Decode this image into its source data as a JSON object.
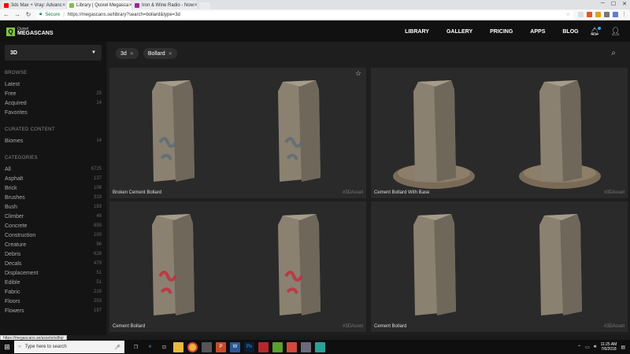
{
  "browser": {
    "tabs": [
      {
        "title": "3ds Max + Vray: Advanc",
        "color": "#ff0000",
        "active": false
      },
      {
        "title": "Library | Quixel Megasca",
        "color": "#7fc241",
        "active": true
      },
      {
        "title": "Iron & Wine Radio - Now",
        "color": "#a0249b",
        "active": false
      }
    ],
    "secure_label": "Secure",
    "url": "https://megascans.se/library?search=bollard&type=3d",
    "status_url": "https://megascans.se/assets/sdhqr"
  },
  "header": {
    "logo_mark": "Q",
    "logo_small": "Quixel",
    "logo_big": "MEGASCANS",
    "nav": [
      "LIBRARY",
      "GALLERY",
      "PRICING",
      "APPS",
      "BLOG"
    ]
  },
  "sidebar": {
    "type_select": "3D",
    "browse_title": "BROWSE",
    "browse": [
      {
        "label": "Latest",
        "count": ""
      },
      {
        "label": "Free",
        "count": "25"
      },
      {
        "label": "Acquired",
        "count": "14"
      },
      {
        "label": "Favorites",
        "count": ""
      }
    ],
    "curated_title": "CURATED CONTENT",
    "curated": [
      {
        "label": "Biomes",
        "count": "14"
      }
    ],
    "categories_title": "CATEGORIES",
    "categories": [
      {
        "label": "All",
        "count": "6725"
      },
      {
        "label": "Asphalt",
        "count": "137"
      },
      {
        "label": "Brick",
        "count": "108"
      },
      {
        "label": "Brushes",
        "count": "319"
      },
      {
        "label": "Bush",
        "count": "183"
      },
      {
        "label": "Climber",
        "count": "48"
      },
      {
        "label": "Concrete",
        "count": "855"
      },
      {
        "label": "Construction",
        "count": "100"
      },
      {
        "label": "Creature",
        "count": "96"
      },
      {
        "label": "Debris",
        "count": "628"
      },
      {
        "label": "Decals",
        "count": "479"
      },
      {
        "label": "Displacement",
        "count": "51"
      },
      {
        "label": "Edible",
        "count": "51"
      },
      {
        "label": "Fabric",
        "count": "216"
      },
      {
        "label": "Floors",
        "count": "253"
      },
      {
        "label": "Flowers",
        "count": "197"
      }
    ]
  },
  "search": {
    "chips": [
      "3d",
      "Bollard"
    ]
  },
  "results": [
    {
      "name": "Broken Cement Bollard",
      "tag": "#3DAsset",
      "graffiti": "#5d6a78"
    },
    {
      "name": "Cement Bollard With Base",
      "tag": "#3DAsset",
      "graffiti": ""
    },
    {
      "name": "Cement Bollard",
      "tag": "#3DAsset",
      "graffiti": "#c8283a"
    },
    {
      "name": "Cement Bollard",
      "tag": "#3DAsset",
      "graffiti": ""
    }
  ],
  "taskbar": {
    "search_placeholder": "Type here to search",
    "time": "11:25 AM",
    "date": "7/6/2018"
  }
}
